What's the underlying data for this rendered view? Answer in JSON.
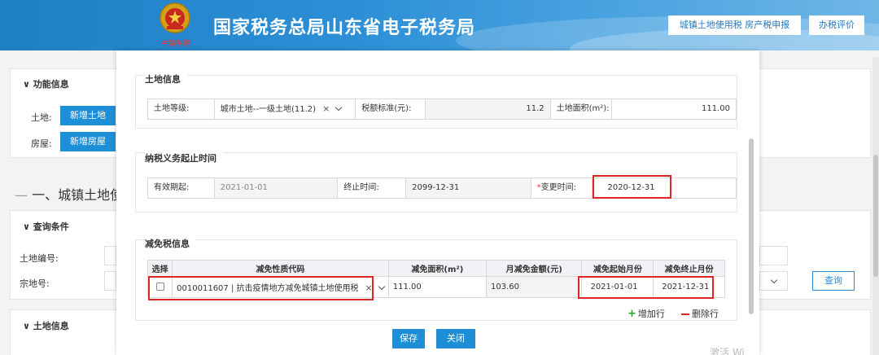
{
  "header": {
    "site_title": "国家税务总局山东省电子税务局",
    "emblem_text": "中國稅務",
    "btn_tax_declare": "城镇土地使用税 房产税申报",
    "btn_evaluate": "办税评价"
  },
  "background": {
    "func_info_title": "功能信息",
    "land_label": "土地:",
    "add_land": "新增土地",
    "house_label": "房屋:",
    "add_house": "新增房屋",
    "section_heading": "一、城镇土地使",
    "query_title": "查询条件",
    "land_no_label": "土地编号:",
    "parcel_no_label": "宗地号:",
    "query_button": "查询",
    "land_info_title": "土地信息"
  },
  "modal": {
    "land_info": {
      "title": "土地信息",
      "grade_label": "土地等级:",
      "grade_value": "城市土地--一级土地(11.2)",
      "grade_clear": "×",
      "rate_label": "税额标准(元):",
      "rate_value": "11.2",
      "area_label": "土地面积(m²):",
      "area_value": "111.00"
    },
    "tax_period": {
      "title": "纳税义务起止时间",
      "start_label": "有效期起:",
      "start_value": "2021-01-01",
      "end_label": "终止时间:",
      "end_value": "2099-12-31",
      "change_req": "*",
      "change_label": "变更时间:",
      "change_value": "2020-12-31"
    },
    "relief": {
      "title": "减免税信息",
      "columns": [
        "选择",
        "减免性质代码",
        "减免面积(m²)",
        "月减免金额(元)",
        "减免起始月份",
        "减免终止月份"
      ],
      "row": {
        "code": "0010011607 | 抗击疫情地方减免城镇土地使用税",
        "clear": "×",
        "area": "111.00",
        "amount": "103.60",
        "start_month": "2021-01-01",
        "end_month": "2021-12-31"
      },
      "add_row": "增加行",
      "del_row": "删除行"
    },
    "save_button": "保存",
    "close_button": "关闭"
  },
  "watermark": "激活 Wi"
}
